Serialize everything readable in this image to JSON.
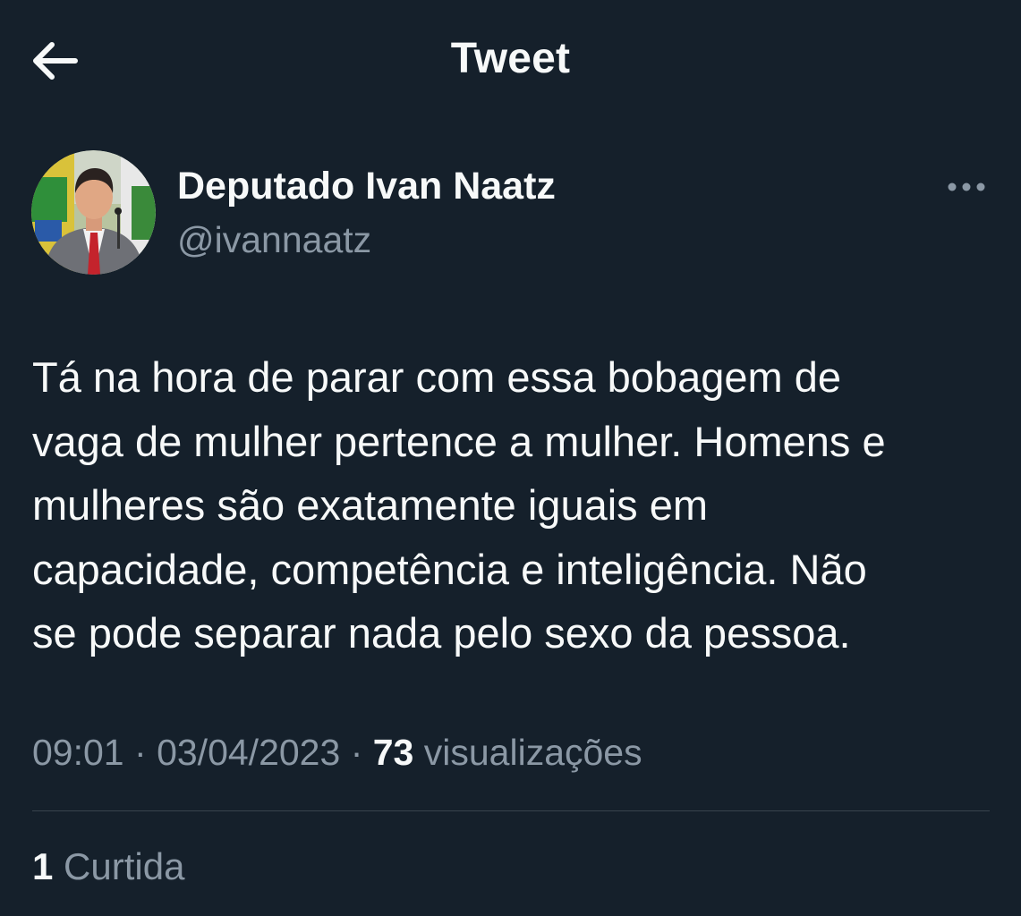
{
  "header": {
    "title": "Tweet",
    "back_icon": "arrow-left-icon"
  },
  "author": {
    "display_name": "Deputado Ivan Naatz",
    "handle": "@ivannaatz",
    "avatar_icon": "profile-photo"
  },
  "more_icon": "more-horizontal-icon",
  "tweet": {
    "text": "Tá na hora de parar com essa bobagem de\nvaga de mulher pertence a mulher. Homens e\nmulheres são exatamente iguais em\ncapacidade, competência e inteligência. Não\nse pode separar nada pelo sexo da pessoa."
  },
  "meta": {
    "time": "09:01",
    "separator": "·",
    "date": "03/04/2023",
    "views_count": "73",
    "views_label": "visualizações"
  },
  "stats": {
    "likes_count": "1",
    "likes_label": "Curtida"
  },
  "colors": {
    "background": "#15202b",
    "text_primary": "#f7f9f9",
    "text_secondary": "#8b98a5",
    "divider": "#38444d"
  }
}
